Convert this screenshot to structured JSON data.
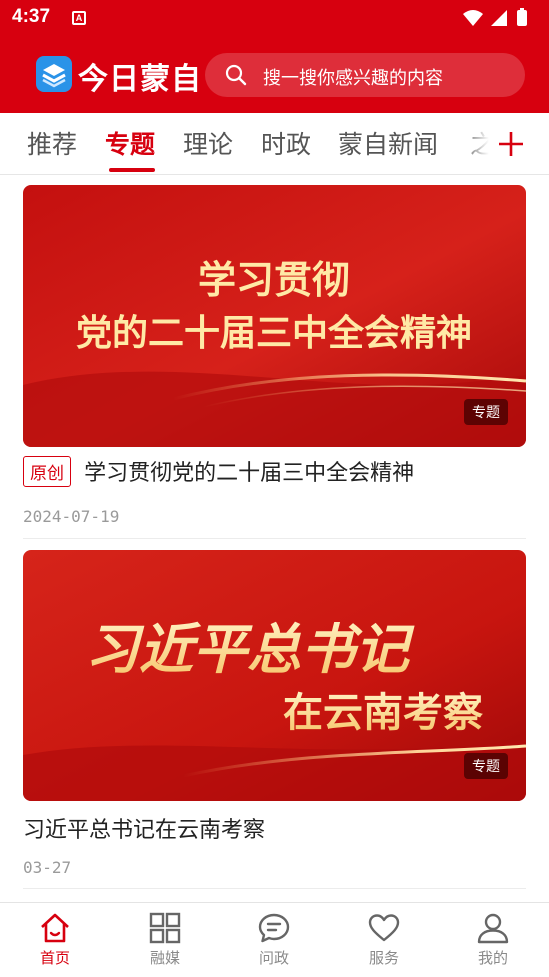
{
  "status_bar": {
    "time": "4:37",
    "notification_icon": "A"
  },
  "app_bar": {
    "logo_text": "今日蒙自",
    "search_placeholder": "搜一搜你感兴趣的内容"
  },
  "tabs": [
    {
      "label": "推荐",
      "active": false
    },
    {
      "label": "专题",
      "active": true
    },
    {
      "label": "理论",
      "active": false
    },
    {
      "label": "时政",
      "active": false
    },
    {
      "label": "蒙自新闻",
      "active": false
    },
    {
      "label": "之",
      "active": false
    }
  ],
  "cards": [
    {
      "banner_line1": "学习贯彻",
      "banner_line2": "党的二十届三中全会精神",
      "badge": "专题",
      "tag": "原创",
      "title": "学习贯彻党的二十届三中全会精神",
      "date": "2024-07-19"
    },
    {
      "banner_line1": "习近平总书记",
      "banner_line2": "在云南考察",
      "badge": "专题",
      "title": "习近平总书记在云南考察",
      "date": "03-27"
    }
  ],
  "bottom_nav": [
    {
      "label": "首页",
      "icon": "home-icon",
      "active": true
    },
    {
      "label": "融媒",
      "icon": "grid-icon",
      "active": false
    },
    {
      "label": "问政",
      "icon": "chat-icon",
      "active": false
    },
    {
      "label": "服务",
      "icon": "heart-icon",
      "active": false
    },
    {
      "label": "我的",
      "icon": "user-icon",
      "active": false
    }
  ],
  "colors": {
    "brand_red": "#d7000f",
    "logo_blue": "#2a93e8",
    "gold": "#ffe9a6"
  }
}
